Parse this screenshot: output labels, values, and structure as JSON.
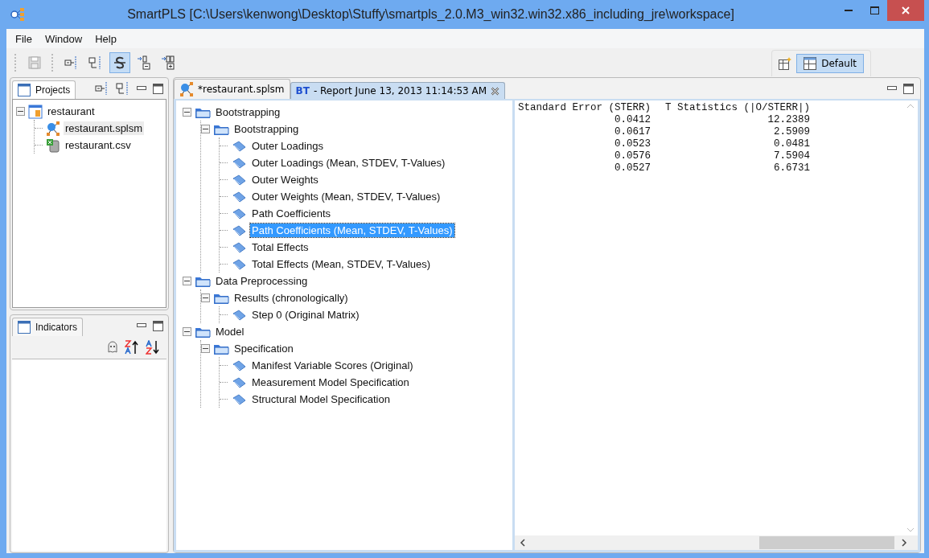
{
  "window": {
    "title": "SmartPLS [C:\\Users\\kenwong\\Desktop\\Stuffy\\smartpls_2.0.M3_win32.win32.x86_including_jre\\workspace]"
  },
  "menu": [
    "File",
    "Window",
    "Help"
  ],
  "toolbar": [
    {
      "kind": "save",
      "disabled": true,
      "pressed": false
    },
    {
      "kind": "expand",
      "disabled": false,
      "pressed": false
    },
    {
      "kind": "collapse",
      "disabled": false,
      "pressed": false
    },
    {
      "kind": "strike",
      "disabled": false,
      "pressed": true
    },
    {
      "kind": "remove",
      "disabled": false,
      "pressed": false
    },
    {
      "kind": "add",
      "disabled": false,
      "pressed": false
    }
  ],
  "perspective": {
    "label": "Default",
    "selected": true
  },
  "projects_panel": {
    "title": "Projects",
    "tree": [
      {
        "label": "restaurant",
        "kind": "project",
        "expanded": true,
        "selected": false,
        "children": [
          {
            "label": "restaurant.splsm",
            "kind": "model",
            "selected": true
          },
          {
            "label": "restaurant.csv",
            "kind": "csv",
            "selected": false
          }
        ]
      }
    ]
  },
  "indicators_panel": {
    "title": "Indicators"
  },
  "editor_tabs": [
    {
      "label": "*restaurant.splsm",
      "kind": "model",
      "selected": false
    },
    {
      "prefix": "BT",
      "label": "- Report June 13, 2013 11:14:53 AM",
      "selected": true
    }
  ],
  "report_tree": [
    {
      "label": "Bootstrapping",
      "kind": "folder",
      "expanded": true,
      "selected": false,
      "children": [
        {
          "label": "Bootstrapping",
          "kind": "folder",
          "expanded": true,
          "selected": false,
          "children": [
            {
              "label": "Outer Loadings",
              "kind": "report",
              "selected": false
            },
            {
              "label": "Outer Loadings (Mean, STDEV, T-Values)",
              "kind": "report",
              "selected": false
            },
            {
              "label": "Outer Weights",
              "kind": "report",
              "selected": false
            },
            {
              "label": "Outer Weights (Mean, STDEV, T-Values)",
              "kind": "report",
              "selected": false
            },
            {
              "label": "Path Coefficients",
              "kind": "report",
              "selected": false
            },
            {
              "label": "Path Coefficients (Mean, STDEV, T-Values)",
              "kind": "report",
              "selected": true
            },
            {
              "label": "Total Effects",
              "kind": "report",
              "selected": false
            },
            {
              "label": "Total Effects (Mean, STDEV, T-Values)",
              "kind": "report",
              "selected": false
            }
          ]
        }
      ]
    },
    {
      "label": "Data Preprocessing",
      "kind": "folder",
      "expanded": true,
      "selected": false,
      "children": [
        {
          "label": "Results (chronologically)",
          "kind": "folder",
          "expanded": true,
          "selected": false,
          "children": [
            {
              "label": "Step 0 (Original Matrix)",
              "kind": "report",
              "selected": false
            }
          ]
        }
      ]
    },
    {
      "label": "Model",
      "kind": "folder",
      "expanded": true,
      "selected": false,
      "children": [
        {
          "label": "Specification",
          "kind": "folder",
          "expanded": true,
          "selected": false,
          "children": [
            {
              "label": "Manifest Variable Scores (Original)",
              "kind": "report",
              "selected": false
            },
            {
              "label": "Measurement Model Specification",
              "kind": "report",
              "selected": false
            },
            {
              "label": "Structural Model Specification",
              "kind": "report",
              "selected": false
            }
          ]
        }
      ]
    }
  ],
  "report_table": {
    "columns": [
      "Standard Error (STERR)",
      "T Statistics (|O/STERR|)"
    ],
    "rows": [
      [
        "0.0412",
        "12.2389"
      ],
      [
        "0.0617",
        "2.5909"
      ],
      [
        "0.0523",
        "0.0481"
      ],
      [
        "0.0576",
        "7.5904"
      ],
      [
        "0.0527",
        "6.6731"
      ]
    ]
  }
}
